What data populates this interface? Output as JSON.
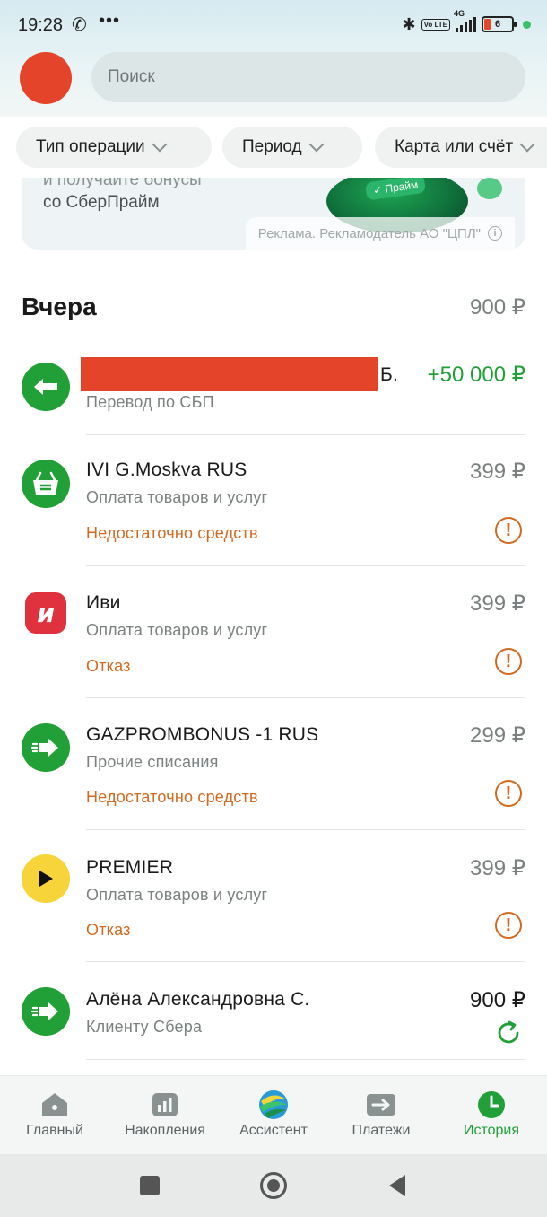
{
  "status_bar": {
    "time": "19:28",
    "phone_icon": "phone-icon",
    "dots": "•••",
    "network": "4G",
    "volte": "Vo LTE",
    "battery": "6"
  },
  "header": {
    "search_placeholder": "Поиск"
  },
  "filters": [
    {
      "label": "Тип операции"
    },
    {
      "label": "Период"
    },
    {
      "label": "Карта или счёт"
    }
  ],
  "ad": {
    "line1": "и получайте бонусы",
    "line2": "со СберПрайм",
    "badge": "Прайм",
    "disclaimer": "Реклама. Рекламодатель АО \"ЦПЛ\""
  },
  "section": {
    "title": "Вчера",
    "total": "900 ₽"
  },
  "transactions": [
    {
      "title_suffix": "Б.",
      "subtitle": "Перевод по СБП",
      "amount": "+50 000 ₽",
      "status": "",
      "icon": "incoming-transfer-icon",
      "color": "#21a038"
    },
    {
      "title": "IVI G.Moskva RUS",
      "subtitle": "Оплата товаров и услуг",
      "amount": "399 ₽",
      "status": "Недостаточно средств",
      "icon": "shopping-basket-icon",
      "color": "#21a038"
    },
    {
      "title": "Иви",
      "subtitle": "Оплата товаров и услуг",
      "amount": "399 ₽",
      "status": "Отказ",
      "icon": "ivi-logo-icon",
      "color": "#e0323e"
    },
    {
      "title": "GAZPROMBONUS -1 RUS",
      "subtitle": "Прочие списания",
      "amount": "299 ₽",
      "status": "Недостаточно средств",
      "icon": "outgoing-transfer-icon",
      "color": "#21a038"
    },
    {
      "title": "PREMIER",
      "subtitle": "Оплата товаров и услуг",
      "amount": "399 ₽",
      "status": "Отказ",
      "icon": "play-icon",
      "color": "#f6d43a"
    },
    {
      "title": "Алёна Александровна С.",
      "subtitle": "Клиенту Сбера",
      "amount": "900 ₽",
      "status": "",
      "icon": "outgoing-transfer-icon",
      "color": "#21a038"
    }
  ],
  "bottom_nav": [
    {
      "label": "Главный",
      "icon": "home-icon"
    },
    {
      "label": "Накопления",
      "icon": "savings-chart-icon"
    },
    {
      "label": "Ассистент",
      "icon": "assistant-icon"
    },
    {
      "label": "Платежи",
      "icon": "payments-icon"
    },
    {
      "label": "История",
      "icon": "history-clock-icon",
      "active": true
    }
  ],
  "colors": {
    "accent": "#21a038",
    "warning": "#d2691e",
    "avatar": "#e4442a"
  }
}
